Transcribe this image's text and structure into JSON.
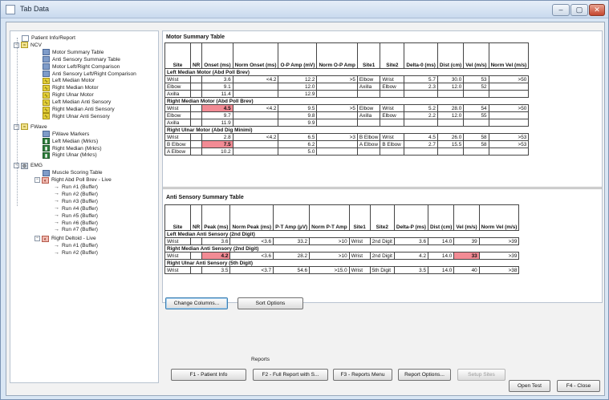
{
  "window": {
    "title": "Tab Data",
    "min": "–",
    "max": "▢",
    "close": "✕"
  },
  "tree": [
    {
      "label": "Patient Info/Report",
      "icon": "doc"
    },
    {
      "label": "NCV",
      "icon": "grp",
      "exp": "−"
    },
    {
      "label": "Motor Summary Table",
      "icon": "tbl"
    },
    {
      "label": "Anti Sensory Summary Table",
      "icon": "tbl"
    },
    {
      "label": "Motor Left/Right Comparison",
      "icon": "tbl"
    },
    {
      "label": "Anti Sensory Left/Right Comparison",
      "icon": "tbl"
    },
    {
      "label": "Left Median Motor",
      "icon": "wave"
    },
    {
      "label": "Right Median Motor",
      "icon": "wave"
    },
    {
      "label": "Right Ulnar Motor",
      "icon": "wave"
    },
    {
      "label": "Left Median Anti Sensory",
      "icon": "wave"
    },
    {
      "label": "Right Median Anti Sensory",
      "icon": "wave"
    },
    {
      "label": "Right Ulnar Anti Sensory",
      "icon": "wave"
    },
    {
      "label": "FWave",
      "icon": "grp",
      "exp": "−"
    },
    {
      "label": "FWave Markers",
      "icon": "tbl"
    },
    {
      "label": "Left Median (Mrkrs)",
      "icon": "blk"
    },
    {
      "label": "Right Median (Mrkrs)",
      "icon": "blk"
    },
    {
      "label": "Right Ulnar (Mrkrs)",
      "icon": "blk"
    },
    {
      "label": "EMG",
      "icon": "emg",
      "exp": "−"
    },
    {
      "label": "Muscle Scoring Table",
      "icon": "tbl"
    },
    {
      "label": "Right Abd Poll Brev - Live",
      "icon": "mus",
      "exp": "−"
    },
    {
      "label": "Run #1 (Buffer)",
      "icon": "arr"
    },
    {
      "label": "Run #2 (Buffer)",
      "icon": "arr"
    },
    {
      "label": "Run #3 (Buffer)",
      "icon": "arr"
    },
    {
      "label": "Run #4 (Buffer)",
      "icon": "arr"
    },
    {
      "label": "Run #5 (Buffer)",
      "icon": "arr"
    },
    {
      "label": "Run #6 (Buffer)",
      "icon": "arr"
    },
    {
      "label": "Run #7 (Buffer)",
      "icon": "arr"
    },
    {
      "label": "Right Deltoid - Live",
      "icon": "mus",
      "exp": "−"
    },
    {
      "label": "Run #1 (Buffer)",
      "icon": "arr"
    },
    {
      "label": "Run #2 (Buffer)",
      "icon": "arr"
    }
  ],
  "motor": {
    "title": "Motor Summary Table",
    "headers": [
      "Site",
      "NR",
      "Onset (ms)",
      "Norm Onset (ms)",
      "O-P Amp (mV)",
      "Norm O-P Amp",
      "Site1",
      "Site2",
      "Delta-0 (ms)",
      "Dist (cm)",
      "Vel (m/s)",
      "Norm Vel (m/s)"
    ],
    "groups": [
      {
        "name": "Left Median Motor (Abd Poll Brev)",
        "rows": [
          [
            "Wrist",
            "",
            "3.6",
            "<4.2",
            "12.2",
            ">5",
            "Elbow",
            "Wrist",
            "5.7",
            "30.0",
            "53",
            ">50"
          ],
          [
            "Elbow",
            "",
            "9.1",
            "",
            "12.0",
            "",
            "Axilla",
            "Elbow",
            "2.3",
            "12.0",
            "52",
            ""
          ],
          [
            "Axilla",
            "",
            "11.4",
            "",
            "12.9",
            "",
            "",
            "",
            "",
            "",
            "",
            ""
          ]
        ]
      },
      {
        "name": "Right Median Motor (Abd Poll Brev)",
        "rows": [
          [
            "Wrist",
            "",
            "4.5",
            "<4.2",
            "9.5",
            ">5",
            "Elbow",
            "Wrist",
            "5.2",
            "28.0",
            "54",
            ">50"
          ],
          [
            "Elbow",
            "",
            "9.7",
            "",
            "9.8",
            "",
            "Axilla",
            "Elbow",
            "2.2",
            "12.0",
            "55",
            ""
          ],
          [
            "Axilla",
            "",
            "11.9",
            "",
            "9.9",
            "",
            "",
            "",
            "",
            "",
            "",
            ""
          ]
        ]
      },
      {
        "name": "Right Ulnar Motor (Abd Dig Minimi)",
        "rows": [
          [
            "Wrist",
            "",
            "2.8",
            "<4.2",
            "6.5",
            ">3",
            "B Elbow",
            "Wrist",
            "4.5",
            "26.0",
            "58",
            ">53"
          ],
          [
            "B Elbow",
            "",
            "7.5",
            "",
            "6.2",
            "",
            "A Elbow",
            "B Elbow",
            "2.7",
            "15.5",
            "58",
            ">53"
          ],
          [
            "A Elbow",
            "",
            "10.2",
            "",
            "5.0",
            "",
            "",
            "",
            "",
            "",
            "",
            ""
          ]
        ]
      }
    ]
  },
  "sensory": {
    "title": "Anti Sensory Summary Table",
    "headers": [
      "Site",
      "NR",
      "Peak (ms)",
      "Norm Peak (ms)",
      "P-T Amp (µV)",
      "Norm P-T Amp",
      "Site1",
      "Site2",
      "Delta-P (ms)",
      "Dist (cm)",
      "Vel (m/s)",
      "Norm Vel (m/s)"
    ],
    "groups": [
      {
        "name": "Left Median Anti Sensory (2nd Digit)",
        "rows": [
          [
            "Wrist",
            "",
            "3.6",
            "<3.6",
            "33.2",
            ">10",
            "Wrist",
            "2nd Digit",
            "3.6",
            "14.0",
            "39",
            ">39"
          ]
        ]
      },
      {
        "name": "Right Median Anti Sensory (2nd Digit)",
        "rows": [
          [
            "Wrist",
            "",
            "4.2",
            "<3.6",
            "28.2",
            ">10",
            "Wrist",
            "2nd Digit",
            "4.2",
            "14.0",
            "33",
            ">39"
          ]
        ]
      },
      {
        "name": "Right Ulnar Anti Sensory (5th Digit)",
        "rows": [
          [
            "Wrist",
            "",
            "3.5",
            "<3.7",
            "54.6",
            ">15.0",
            "Wrist",
            "5th Digit",
            "3.5",
            "14.0",
            "40",
            ">38"
          ]
        ]
      }
    ]
  },
  "highlights": [
    [
      1,
      0,
      2
    ],
    [
      1,
      0,
      10
    ],
    [
      2,
      1,
      2
    ],
    [
      2,
      1,
      10
    ]
  ],
  "buttons": {
    "change_columns": "Change Columns...",
    "sort_options": "Sort Options",
    "reports_label": "Reports",
    "f1": "F1 - Patient Info",
    "f2": "F2 - Full Report with S...",
    "f3": "F3 - Reports Menu",
    "report_options": "Report Options...",
    "setup_sites": "Setup Sites",
    "open_test": "Open Test",
    "f4": "F4 - Close"
  }
}
